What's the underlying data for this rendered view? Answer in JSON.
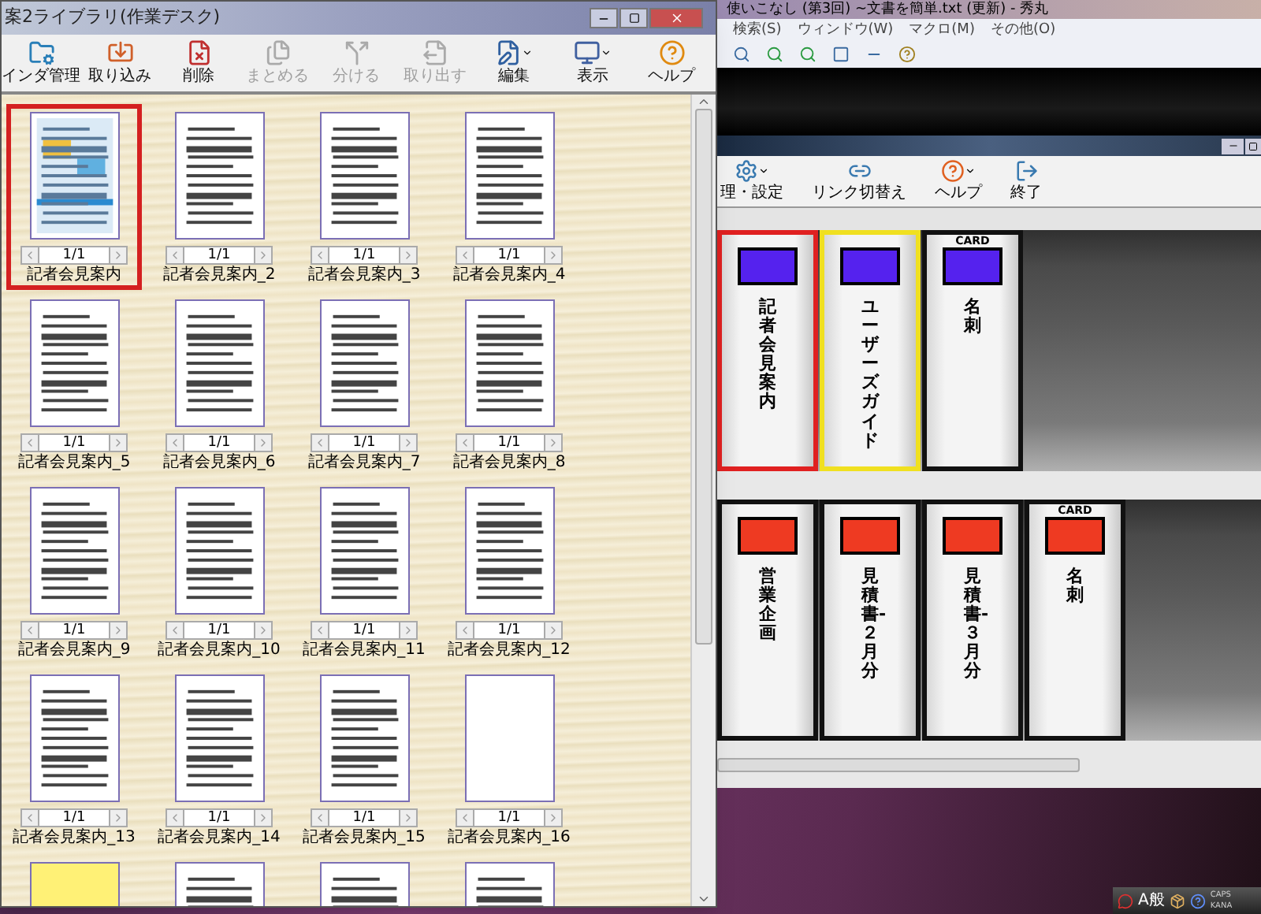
{
  "library_window": {
    "title": "案2ライブラリ(作業デスク)",
    "toolbar": [
      {
        "label": "インダ管理",
        "disabled": false,
        "dropdown": false
      },
      {
        "label": "取り込み",
        "disabled": false,
        "dropdown": false
      },
      {
        "label": "削除",
        "disabled": false,
        "dropdown": false
      },
      {
        "label": "まとめる",
        "disabled": true,
        "dropdown": false
      },
      {
        "label": "分ける",
        "disabled": true,
        "dropdown": false
      },
      {
        "label": "取り出す",
        "disabled": true,
        "dropdown": false
      },
      {
        "label": "編集",
        "disabled": false,
        "dropdown": true
      },
      {
        "label": "表示",
        "disabled": false,
        "dropdown": true
      },
      {
        "label": "ヘルプ",
        "disabled": false,
        "dropdown": false
      }
    ],
    "documents": [
      {
        "name": "記者会見案内",
        "page": "1/1",
        "kind": "color",
        "selected": true
      },
      {
        "name": "記者会見案内_2",
        "page": "1/1",
        "kind": "document",
        "selected": false
      },
      {
        "name": "記者会見案内_3",
        "page": "1/1",
        "kind": "document",
        "selected": false
      },
      {
        "name": "記者会見案内_4",
        "page": "1/1",
        "kind": "document",
        "selected": false
      },
      {
        "name": "記者会見案内_5",
        "page": "1/1",
        "kind": "document",
        "selected": false
      },
      {
        "name": "記者会見案内_6",
        "page": "1/1",
        "kind": "document",
        "selected": false
      },
      {
        "name": "記者会見案内_7",
        "page": "1/1",
        "kind": "document",
        "selected": false
      },
      {
        "name": "記者会見案内_8",
        "page": "1/1",
        "kind": "document",
        "selected": false
      },
      {
        "name": "記者会見案内_9",
        "page": "1/1",
        "kind": "document",
        "selected": false
      },
      {
        "name": "記者会見案内_10",
        "page": "1/1",
        "kind": "document",
        "selected": false
      },
      {
        "name": "記者会見案内_11",
        "page": "1/1",
        "kind": "document",
        "selected": false
      },
      {
        "name": "記者会見案内_12",
        "page": "1/1",
        "kind": "document",
        "selected": false
      },
      {
        "name": "記者会見案内_13",
        "page": "1/1",
        "kind": "document",
        "selected": false
      },
      {
        "name": "記者会見案内_14",
        "page": "1/1",
        "kind": "document",
        "selected": false
      },
      {
        "name": "記者会見案内_15",
        "page": "1/1",
        "kind": "document",
        "selected": false
      },
      {
        "name": "記者会見案内_16",
        "page": "1/1",
        "kind": "blank",
        "selected": false
      }
    ],
    "partial_row": [
      {
        "kind": "sticky"
      },
      {
        "kind": "document"
      },
      {
        "kind": "document"
      },
      {
        "kind": "document"
      }
    ]
  },
  "editor_window": {
    "title": "使いこなし (第3回) ~文書を簡単.txt (更新) - 秀丸",
    "menu": [
      "検索(S)",
      "ウィンドウ(W)",
      "マクロ(M)",
      "その他(O)"
    ]
  },
  "shelf_window": {
    "toolbar": [
      {
        "label": "理・設定",
        "dropdown": true
      },
      {
        "label": "リンク切替え",
        "dropdown": false
      },
      {
        "label": "ヘルプ",
        "dropdown": true
      },
      {
        "label": "終了",
        "dropdown": false
      }
    ],
    "shelves": [
      [
        {
          "title": "記者会見案内",
          "color": "#5522ee",
          "selected": true,
          "flagged": false
        },
        {
          "title": "ユーザーズガイド",
          "color": "#5522ee",
          "selected": false,
          "flagged": true
        },
        {
          "title": "名刺",
          "caption": "CARD",
          "color": "#5522ee",
          "selected": false,
          "flagged": false
        }
      ],
      [
        {
          "title": "営業企画",
          "color": "#ee3a22",
          "selected": false,
          "flagged": false
        },
        {
          "title": "見積書-２月分",
          "color": "#ee3a22",
          "selected": false,
          "flagged": false
        },
        {
          "title": "見積書-３月分",
          "color": "#ee3a22",
          "selected": false,
          "flagged": false
        },
        {
          "title": "名刺",
          "caption": "CARD",
          "color": "#ee3a22",
          "selected": false,
          "flagged": false
        }
      ]
    ]
  },
  "tray": {
    "ime": [
      "A",
      "般"
    ],
    "locks": [
      "CAPS",
      "KANA"
    ]
  }
}
